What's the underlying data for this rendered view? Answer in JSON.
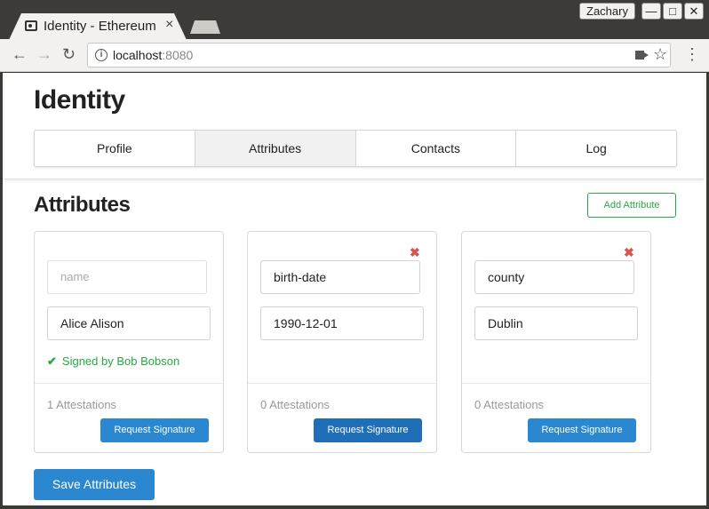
{
  "browser": {
    "tab_title": "Identity - Ethereum",
    "tab_close": "×",
    "user": "Zachary",
    "window_buttons": [
      "—",
      "□",
      "✕"
    ],
    "nav": {
      "back": "←",
      "forward": "→",
      "reload": "↻"
    },
    "url_host": "localhost",
    "url_port": ":8080",
    "info_glyph": "i",
    "star": "☆",
    "menu": "⋮"
  },
  "app": {
    "title": "Identity",
    "tabs": [
      {
        "label": "Profile",
        "active": false
      },
      {
        "label": "Attributes",
        "active": true
      },
      {
        "label": "Contacts",
        "active": false
      },
      {
        "label": "Log",
        "active": false
      }
    ]
  },
  "attributes": {
    "title": "Attributes",
    "add_label": "Add Attribute",
    "remove_glyph": "✖",
    "check_glyph": "✔",
    "cards": [
      {
        "name_value": "",
        "name_placeholder": "name",
        "value": "Alice Alison",
        "signed": "Signed by Bob Bobson",
        "attestations": "1 Attestations",
        "button": "Request Signature",
        "removable": false
      },
      {
        "name_value": "birth-date",
        "value": "1990-12-01",
        "signed": "",
        "attestations": "0 Attestations",
        "button": "Request Signature",
        "removable": true
      },
      {
        "name_value": "county",
        "value": "Dublin",
        "signed": "",
        "attestations": "0 Attestations",
        "button": "Request Signature",
        "removable": true
      }
    ],
    "save_label": "Save Attributes"
  },
  "colors": {
    "primary": "#2a87d0",
    "success": "#28a745",
    "danger": "#d9534f"
  }
}
